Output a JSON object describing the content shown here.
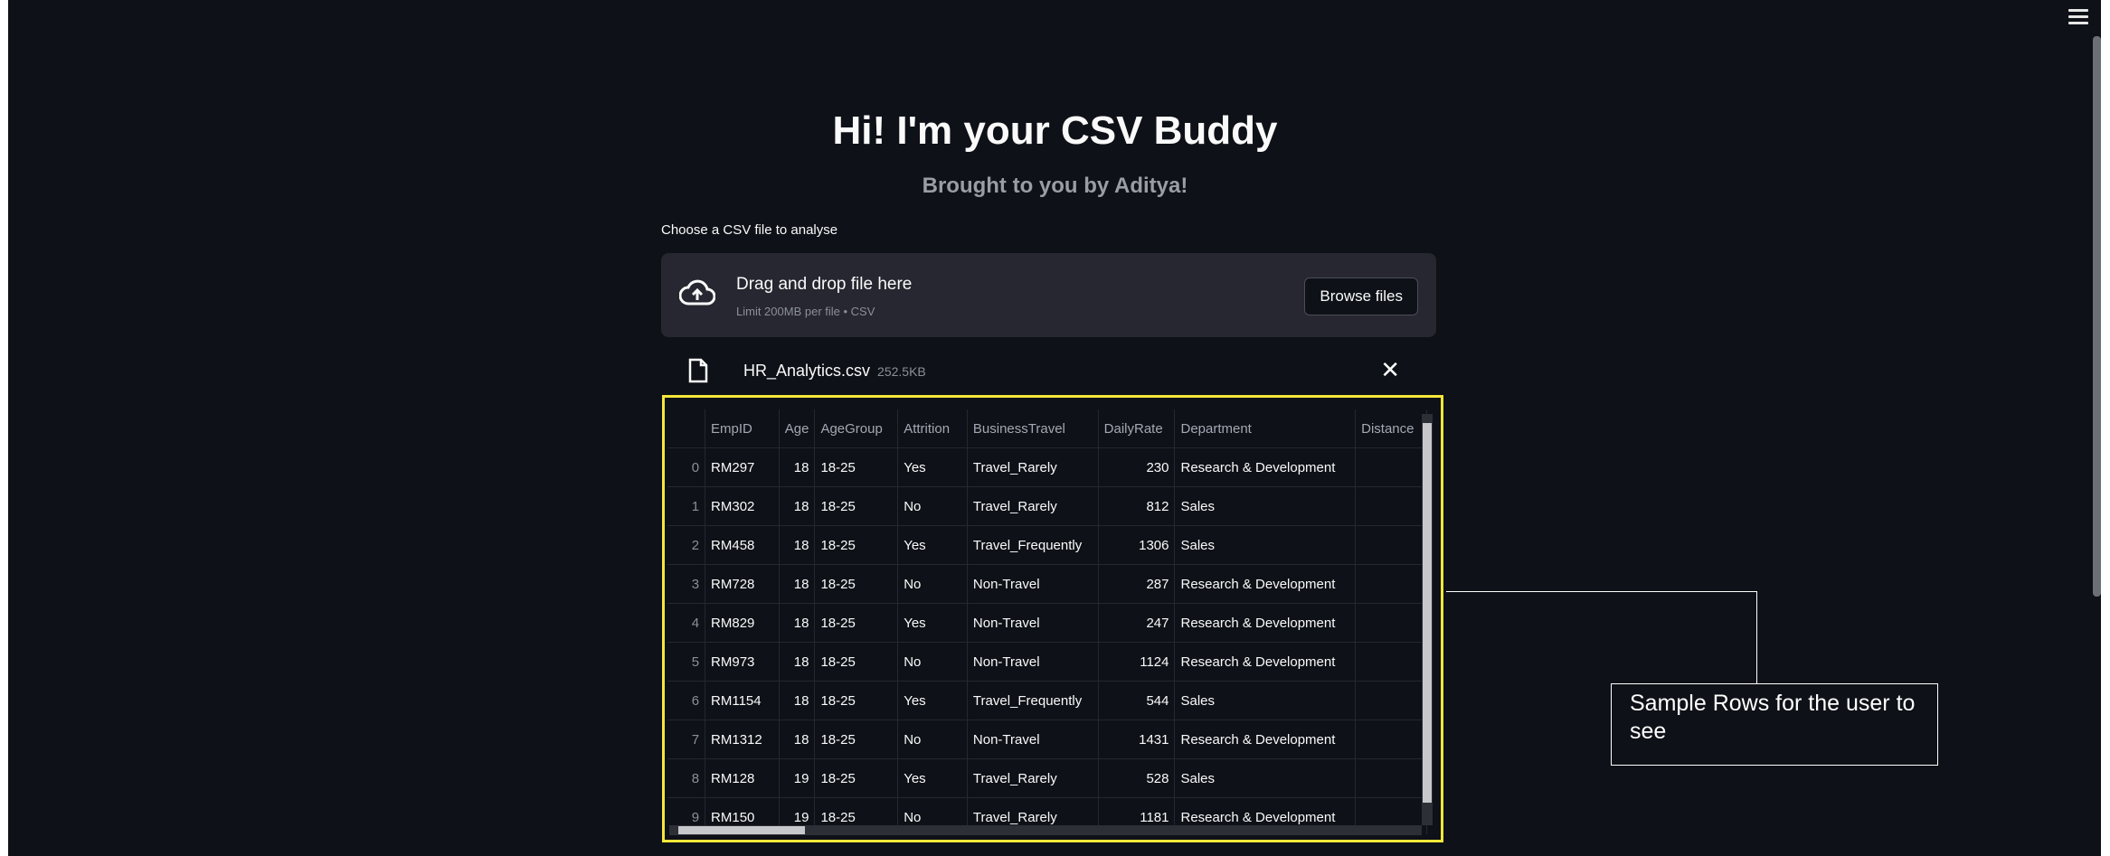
{
  "header": {
    "title": "Hi! I'm your CSV Buddy",
    "subtitle": "Brought to you by Aditya!"
  },
  "uploader": {
    "label": "Choose a CSV file to analyse",
    "drop_title": "Drag and drop file here",
    "drop_hint": "Limit 200MB per file • CSV",
    "browse_label": "Browse files",
    "upload_icon": "cloud-upload-icon"
  },
  "uploaded_file": {
    "name": "HR_Analytics.csv",
    "size": "252.5KB",
    "close_glyph": "✕"
  },
  "dataframe": {
    "columns": [
      "",
      "EmpID",
      "Age",
      "AgeGroup",
      "Attrition",
      "BusinessTravel",
      "DailyRate",
      "Department",
      "Distance"
    ],
    "rows": [
      [
        "0",
        "RM297",
        "18",
        "18-25",
        "Yes",
        "Travel_Rarely",
        "230",
        "Research & Development",
        ""
      ],
      [
        "1",
        "RM302",
        "18",
        "18-25",
        "No",
        "Travel_Rarely",
        "812",
        "Sales",
        ""
      ],
      [
        "2",
        "RM458",
        "18",
        "18-25",
        "Yes",
        "Travel_Frequently",
        "1306",
        "Sales",
        ""
      ],
      [
        "3",
        "RM728",
        "18",
        "18-25",
        "No",
        "Non-Travel",
        "287",
        "Research & Development",
        ""
      ],
      [
        "4",
        "RM829",
        "18",
        "18-25",
        "Yes",
        "Non-Travel",
        "247",
        "Research & Development",
        ""
      ],
      [
        "5",
        "RM973",
        "18",
        "18-25",
        "No",
        "Non-Travel",
        "1124",
        "Research & Development",
        ""
      ],
      [
        "6",
        "RM1154",
        "18",
        "18-25",
        "Yes",
        "Travel_Frequently",
        "544",
        "Sales",
        ""
      ],
      [
        "7",
        "RM1312",
        "18",
        "18-25",
        "No",
        "Non-Travel",
        "1431",
        "Research & Development",
        ""
      ],
      [
        "8",
        "RM128",
        "19",
        "18-25",
        "Yes",
        "Travel_Rarely",
        "528",
        "Sales",
        ""
      ],
      [
        "9",
        "RM150",
        "19",
        "18-25",
        "No",
        "Travel_Rarely",
        "1181",
        "Research & Development",
        ""
      ]
    ]
  },
  "annotation": {
    "callout_text": "Sample Rows for the user to see",
    "highlight_color": "#f5e73a"
  },
  "colors": {
    "background": "#0e1117",
    "dropzone": "#262730",
    "text": "#fafafa",
    "muted": "#8b8f98"
  }
}
